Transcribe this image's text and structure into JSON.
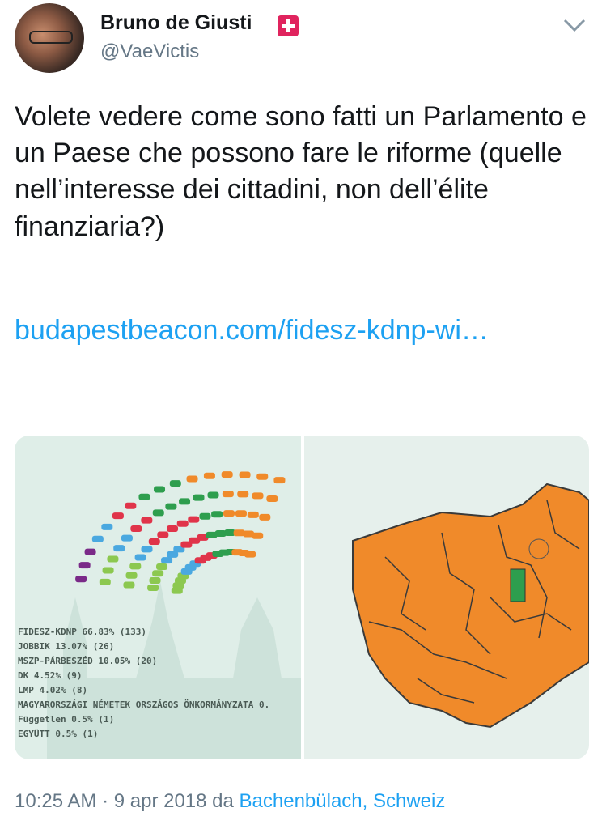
{
  "author": {
    "name": "Bruno de Giusti",
    "handle": "@VaeVictis"
  },
  "tweet": {
    "text": "Volete vedere come sono fatti un Parlamento e un Paese che possono fare le riforme (quelle nell’interesse dei cittadini, non dell’élite finanziaria?)",
    "link": "budapestbeacon.com/fidesz-kdnp-wi…"
  },
  "media": {
    "legend": [
      "FIDESZ-KDNP 66.83% (133)",
      "JOBBIK 13.07% (26)",
      "MSZP-PÁRBESZÉD 10.05% (20)",
      "DK 4.52% (9)",
      "LMP 4.02% (8)",
      "MAGYARORSZÁGI NÉMETEK ORSZÁGOS ÖNKORMÁNYZATA 0.",
      "Független 0.5% (1)",
      "EGYÜTT 0.5% (1)"
    ],
    "colors": {
      "fidesz": "#f08a2a",
      "jobbik": "#2e9e4e",
      "mszp": "#e0344a",
      "dk": "#4aa8e0",
      "lmp": "#8cc850",
      "other": "#7a2a88",
      "background": "#dfeee8",
      "map_district": "#f08a2a"
    }
  },
  "footer": {
    "time": "10:25 AM",
    "sep": " · ",
    "date": "9 apr 2018",
    "da": " da ",
    "place": "Bachenbülach, Schweiz"
  },
  "icons": {
    "verified_flag": "swiss-flag-icon",
    "menu": "chevron-down-icon"
  }
}
